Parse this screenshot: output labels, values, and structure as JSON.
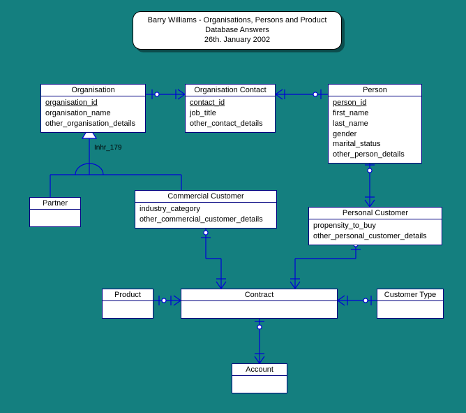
{
  "title": {
    "line1": "Barry Williams - Organisations, Persons and Product",
    "line2": "Database Answers",
    "line3": "26th. January 2002"
  },
  "entities": {
    "organisation": {
      "name": "Organisation",
      "pk": "organisation_id",
      "attrs": [
        "organisation_name",
        "other_organisation_details"
      ]
    },
    "organisation_contact": {
      "name": "Organisation Contact",
      "pk": "contact_id",
      "attrs": [
        "job_title",
        "other_contact_details"
      ]
    },
    "person": {
      "name": "Person",
      "pk": "person_id",
      "attrs": [
        "first_name",
        "last_name",
        "gender",
        "marital_status",
        "other_person_details"
      ]
    },
    "partner": {
      "name": "Partner"
    },
    "commercial_customer": {
      "name": "Commercial Customer",
      "attrs": [
        "industry_category",
        "other_commercial_customer_details"
      ]
    },
    "personal_customer": {
      "name": "Personal Customer",
      "attrs": [
        "propensity_to_buy",
        "other_personal_customer_details"
      ]
    },
    "product": {
      "name": "Product"
    },
    "contract": {
      "name": "Contract"
    },
    "customer_type": {
      "name": "Customer Type"
    },
    "account": {
      "name": "Account"
    }
  },
  "labels": {
    "inheritance": "Inhr_179"
  },
  "chart_data": {
    "type": "er-diagram",
    "title": "Barry Williams - Organisations, Persons and Product",
    "source": "Database Answers",
    "date": "26th. January 2002",
    "entities": [
      {
        "name": "Organisation",
        "pk": [
          "organisation_id"
        ],
        "attributes": [
          "organisation_name",
          "other_organisation_details"
        ]
      },
      {
        "name": "Organisation Contact",
        "pk": [
          "contact_id"
        ],
        "attributes": [
          "job_title",
          "other_contact_details"
        ]
      },
      {
        "name": "Person",
        "pk": [
          "person_id"
        ],
        "attributes": [
          "first_name",
          "last_name",
          "gender",
          "marital_status",
          "other_person_details"
        ]
      },
      {
        "name": "Partner"
      },
      {
        "name": "Commercial Customer",
        "attributes": [
          "industry_category",
          "other_commercial_customer_details"
        ]
      },
      {
        "name": "Personal Customer",
        "attributes": [
          "propensity_to_buy",
          "other_personal_customer_details"
        ]
      },
      {
        "name": "Product"
      },
      {
        "name": "Contract"
      },
      {
        "name": "Customer Type"
      },
      {
        "name": "Account"
      }
    ],
    "inheritance": {
      "label": "Inhr_179",
      "parent": "Organisation",
      "children": [
        "Partner",
        "Commercial Customer"
      ]
    },
    "relationships": [
      {
        "from": "Organisation",
        "to": "Organisation Contact",
        "type": "one-to-many"
      },
      {
        "from": "Person",
        "to": "Organisation Contact",
        "type": "one-to-many"
      },
      {
        "from": "Person",
        "to": "Personal Customer",
        "type": "one-to-many"
      },
      {
        "from": "Commercial Customer",
        "to": "Contract",
        "type": "one-to-many"
      },
      {
        "from": "Personal Customer",
        "to": "Contract",
        "type": "one-to-many"
      },
      {
        "from": "Product",
        "to": "Contract",
        "type": "one-to-many"
      },
      {
        "from": "Customer Type",
        "to": "Contract",
        "type": "one-to-many"
      },
      {
        "from": "Contract",
        "to": "Account",
        "type": "one-to-many"
      }
    ]
  }
}
